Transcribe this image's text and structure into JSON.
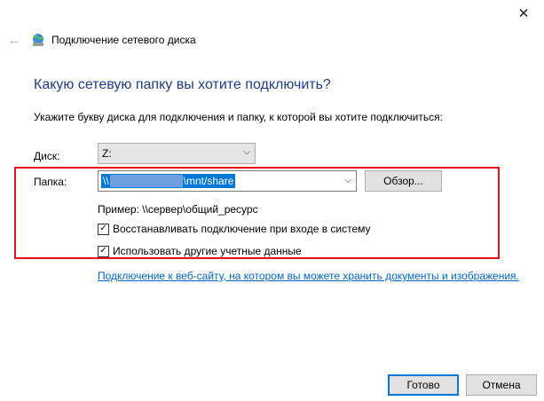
{
  "window": {
    "close_glyph": "✕",
    "back_glyph": "←",
    "title": "Подключение сетевого диска",
    "title_icon": "network-drive-icon"
  },
  "main": {
    "heading": "Какую сетевую папку вы хотите подключить?",
    "description": "Укажите букву диска для подключения и папку, к которой вы хотите подключиться:",
    "drive_label": "Диск:",
    "drive_value": "Z:",
    "folder_label": "Папка:",
    "folder_value_prefix": "\\\\",
    "folder_value_suffix": "\\mnt/share",
    "browse_label": "Обзор...",
    "example": "Пример: \\\\сервер\\общий_ресурс",
    "reconnect_label": "Восстанавливать подключение при входе в систему",
    "reconnect_checked": true,
    "other_creds_label": "Использовать другие учетные данные",
    "other_creds_checked": true,
    "web_link": "Подключение к веб-сайту, на котором вы можете хранить документы и изображения."
  },
  "footer": {
    "ok_label": "Готово",
    "cancel_label": "Отмена"
  },
  "colors": {
    "accent": "#0078d7",
    "heading": "#1f3d8a",
    "highlight": "#e8101a",
    "link": "#0066cc"
  }
}
